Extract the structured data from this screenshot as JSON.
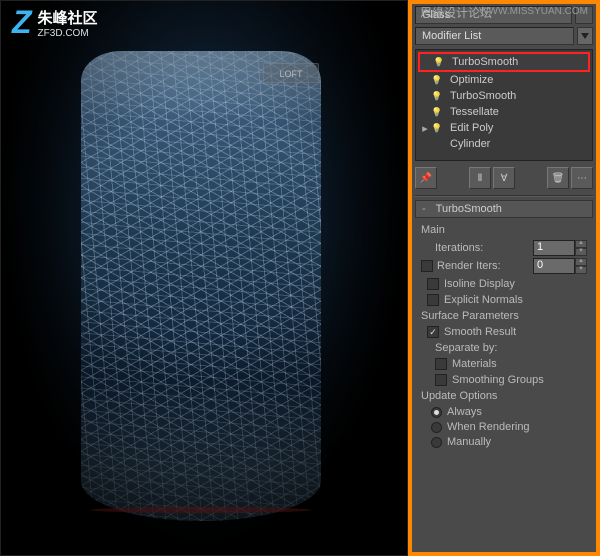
{
  "watermark": {
    "logo_letter": "Z",
    "logo_cn": "朱峰社区",
    "logo_url": "ZF3D.COM",
    "top_label": "思缘设计论坛",
    "top_url": "WWW.MISSYUAN.COM",
    "ghost": "LOFT"
  },
  "object_name": "Glass",
  "modifier_list_label": "Modifier List",
  "modifiers": [
    {
      "label": "TurboSmooth",
      "icon": "bulb",
      "highlighted": true
    },
    {
      "label": "Optimize",
      "icon": "bulb"
    },
    {
      "label": "TurboSmooth",
      "icon": "bulb"
    },
    {
      "label": "Tessellate",
      "icon": "bulb"
    },
    {
      "label": "Edit Poly",
      "icon": "bulb",
      "expandable": true
    },
    {
      "label": "Cylinder",
      "icon": "none"
    }
  ],
  "rollout": {
    "title": "TurboSmooth",
    "main_label": "Main",
    "iterations_label": "Iterations:",
    "iterations_value": "1",
    "render_iters_label": "Render Iters:",
    "render_iters_value": "0",
    "isoline_label": "Isoline Display",
    "explicit_label": "Explicit Normals",
    "surface_params_label": "Surface Parameters",
    "smooth_result_label": "Smooth Result",
    "smooth_result_checked": true,
    "separate_label": "Separate by:",
    "materials_label": "Materials",
    "smoothing_groups_label": "Smoothing Groups",
    "update_label": "Update Options",
    "always_label": "Always",
    "when_rendering_label": "When Rendering",
    "manually_label": "Manually"
  }
}
